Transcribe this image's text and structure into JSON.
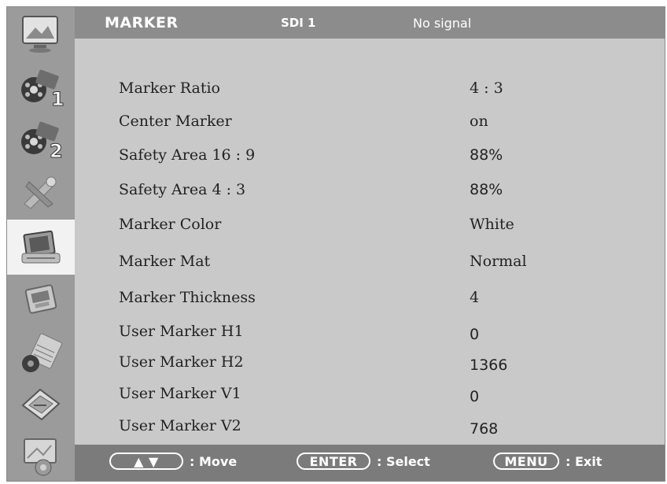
{
  "header": {
    "title": "MARKER",
    "input": "SDI 1",
    "status": "No signal"
  },
  "sidebar": {
    "items": [
      {
        "icon": "picture-icon",
        "active": false
      },
      {
        "icon": "input-1-icon",
        "badge": "1",
        "active": false
      },
      {
        "icon": "input-2-icon",
        "badge": "2",
        "active": false
      },
      {
        "icon": "tools-icon",
        "active": false
      },
      {
        "icon": "marker-icon",
        "active": true
      },
      {
        "icon": "function-icon",
        "active": false
      },
      {
        "icon": "audio-icon",
        "active": false
      },
      {
        "icon": "network-icon",
        "active": false
      },
      {
        "icon": "system-icon",
        "active": false
      }
    ]
  },
  "settings": [
    {
      "label": "Marker Ratio",
      "value": "4 : 3"
    },
    {
      "label": "Center Marker",
      "value": "on"
    },
    {
      "label": "Safety Area 16 : 9",
      "value": "88%"
    },
    {
      "label": "Safety Area 4 : 3",
      "value": "88%"
    },
    {
      "label": "Marker Color",
      "value": "White"
    },
    {
      "label": "Marker Mat",
      "value": "Normal"
    },
    {
      "label": "Marker Thickness",
      "value": "4"
    },
    {
      "label": "User Marker H1",
      "value": "0"
    },
    {
      "label": "User Marker H2",
      "value": "1366"
    },
    {
      "label": "User Marker V1",
      "value": "0"
    },
    {
      "label": "User Marker V2",
      "value": "768"
    }
  ],
  "footer": {
    "move_key": "▲ ▼",
    "move_label": ": Move",
    "select_key": "ENTER",
    "select_label": ": Select",
    "exit_key": "MENU",
    "exit_label": ": Exit"
  }
}
